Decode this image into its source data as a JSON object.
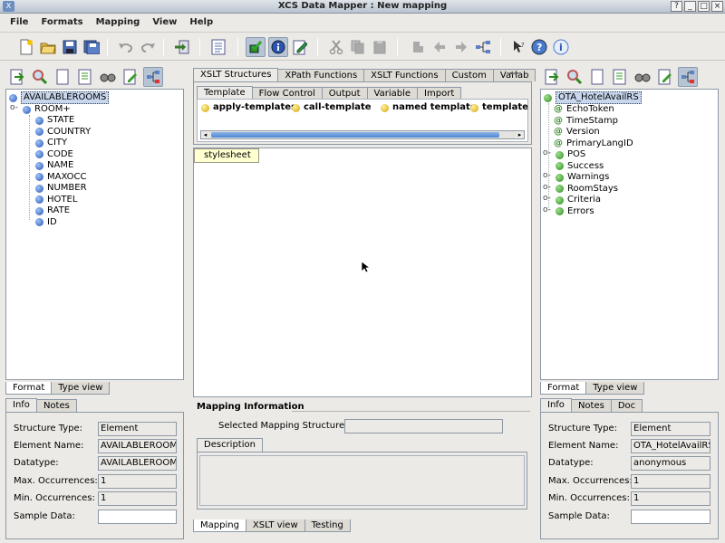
{
  "window": {
    "title": "XCS Data Mapper : New mapping",
    "controls": [
      "?",
      "_",
      "□",
      "×"
    ]
  },
  "menu": [
    "File",
    "Formats",
    "Mapping",
    "View",
    "Help"
  ],
  "toolbar_icons": [
    "new-file-icon",
    "open-folder-icon",
    "save-icon",
    "save-all-icon",
    "undo-icon",
    "redo-icon",
    "export-icon",
    "properties-icon",
    "validate-icon",
    "info-icon",
    "edit-icon",
    "cut-icon",
    "copy-icon",
    "paste-icon",
    "map-icon",
    "map-left-icon",
    "map-right-icon",
    "tree-icon",
    "pointer-help-icon",
    "help-icon",
    "about-icon"
  ],
  "left": {
    "tree": {
      "root": "AVAILABLEROOMS",
      "child": "ROOM+",
      "leaves": [
        "STATE",
        "COUNTRY",
        "CITY",
        "CODE",
        "NAME",
        "MAXOCC",
        "NUMBER",
        "HOTEL",
        "RATE",
        "ID"
      ]
    },
    "view_tabs": [
      "Format",
      "Type view"
    ],
    "info_tabs": [
      "Info",
      "Notes"
    ],
    "info": {
      "structure_type_label": "Structure Type:",
      "structure_type": "Element",
      "element_name_label": "Element Name:",
      "element_name": "AVAILABLEROOMS",
      "datatype_label": "Datatype:",
      "datatype": "AVAILABLEROOMS_",
      "max_occ_label": "Max. Occurrences:",
      "max_occ": "1",
      "min_occ_label": "Min. Occurrences:",
      "min_occ": "1",
      "sample_label": "Sample Data:",
      "sample": ""
    }
  },
  "center": {
    "top_tabs": [
      "XSLT Structures",
      "XPath Functions",
      "XSLT Functions",
      "Custom",
      "Variab"
    ],
    "sub_tabs": [
      "Template",
      "Flow Control",
      "Output",
      "Variable",
      "Import"
    ],
    "palette": [
      "apply-templates",
      "call-template",
      "named template",
      "template"
    ],
    "canvas_node": "stylesheet",
    "mapping_info_title": "Mapping Information",
    "selected_structure_label": "Selected Mapping Structure:",
    "selected_structure_value": "",
    "description_tab": "Description",
    "description": "",
    "bottom_tabs": [
      "Mapping",
      "XSLT view",
      "Testing"
    ]
  },
  "right": {
    "tree": {
      "root": "OTA_HotelAvailRS",
      "attributes": [
        "EchoToken",
        "TimeStamp",
        "Version",
        "PrimaryLangID"
      ],
      "elements": [
        {
          "name": "POS",
          "expandable": true
        },
        {
          "name": "Success",
          "expandable": false
        },
        {
          "name": "Warnings",
          "expandable": true
        },
        {
          "name": "RoomStays",
          "expandable": true
        },
        {
          "name": "Criteria",
          "expandable": true
        },
        {
          "name": "Errors",
          "expandable": true
        }
      ]
    },
    "view_tabs": [
      "Format",
      "Type view"
    ],
    "info_tabs": [
      "Info",
      "Notes",
      "Doc"
    ],
    "info": {
      "structure_type_label": "Structure Type:",
      "structure_type": "Element",
      "element_name_label": "Element Name:",
      "element_name": "OTA_HotelAvailRS",
      "datatype_label": "Datatype:",
      "datatype": "anonymous",
      "max_occ_label": "Max. Occurrences:",
      "max_occ": "1",
      "min_occ_label": "Min. Occurrences:",
      "min_occ": "1",
      "sample_label": "Sample Data:",
      "sample": ""
    }
  }
}
